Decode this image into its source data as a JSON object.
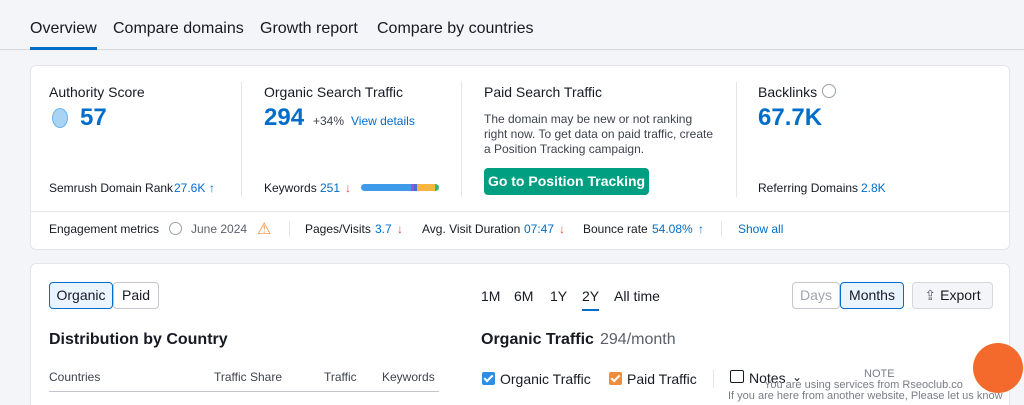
{
  "tabs": [
    "Overview",
    "Compare domains",
    "Growth report",
    "Compare by countries"
  ],
  "authority": {
    "label": "Authority Score",
    "value": "57",
    "rank_label": "Semrush Domain Rank",
    "rank_value": "27.6K",
    "rank_trend": "↑"
  },
  "organic": {
    "label": "Organic Search Traffic",
    "value": "294",
    "change": "+34%",
    "details_link": "View details",
    "keywords_label": "Keywords",
    "keywords_value": "251",
    "keywords_trend": "↓"
  },
  "paid": {
    "label": "Paid Search Traffic",
    "description": "The domain may be new or not ranking right now. To get data on paid traffic, create a Position Tracking campaign.",
    "button": "Go to Position Tracking"
  },
  "backlinks": {
    "label": "Backlinks",
    "value": "67.7K",
    "ref_label": "Referring Domains",
    "ref_value": "2.8K"
  },
  "engagement": {
    "label": "Engagement metrics",
    "date": "June 2024",
    "pages_label": "Pages/Visits",
    "pages_value": "3.7",
    "pages_trend": "↓",
    "duration_label": "Avg. Visit Duration",
    "duration_value": "07:47",
    "duration_trend": "↓",
    "bounce_label": "Bounce rate",
    "bounce_value": "54.08%",
    "bounce_trend": "↑",
    "show_all": "Show all"
  },
  "filters": {
    "type_options": [
      "Organic",
      "Paid"
    ],
    "type_selected": "Organic",
    "ranges": [
      "1M",
      "6M",
      "1Y",
      "2Y",
      "All time"
    ],
    "range_selected": "2Y",
    "granularity": [
      "Days",
      "Months"
    ],
    "granularity_selected": "Months",
    "export": "Export"
  },
  "distribution": {
    "title": "Distribution by Country",
    "columns": [
      "Countries",
      "Traffic Share",
      "Traffic",
      "Keywords"
    ]
  },
  "organic_traffic": {
    "title": "Organic Traffic",
    "value": "294/month",
    "legend_organic": "Organic Traffic",
    "legend_paid": "Paid Traffic",
    "notes": "Notes",
    "organic_color": "#2e8ee6",
    "paid_color": "#f08c3c"
  },
  "notice": {
    "title": "NOTE",
    "line1": "You are using services from Rseoclub.co",
    "line2": "If you are here from another website, Please let us know"
  }
}
